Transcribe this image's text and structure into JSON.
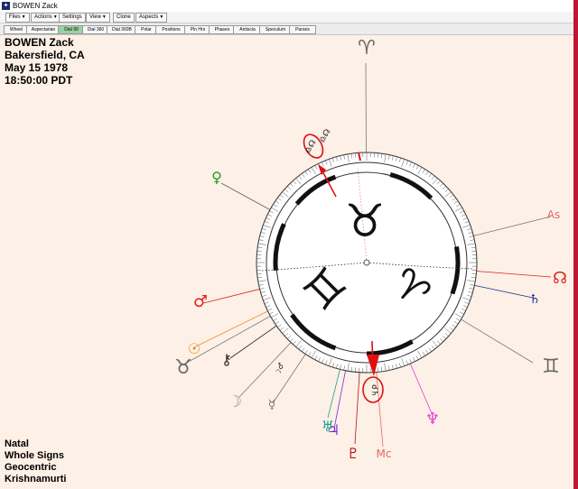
{
  "window": {
    "title": "BOWEN Zack"
  },
  "menu": [
    {
      "label": "Files",
      "dropdown": true
    },
    {
      "label": "Actions",
      "dropdown": true
    },
    {
      "label": "Settings",
      "dropdown": false
    },
    {
      "label": "View",
      "dropdown": true
    },
    {
      "label": "Clone",
      "dropdown": false
    },
    {
      "label": "Aspects",
      "dropdown": true
    }
  ],
  "tabs": [
    "Wheel",
    "Aspectarian",
    "Dial 90",
    "Dial 360",
    "Dial 360B",
    "Polar",
    "Positions",
    "Pln Hrs",
    "Phases",
    "Antiscia",
    "Speculum",
    "Parans"
  ],
  "active_tab": "Dial 90",
  "chart_info": {
    "name": "BOWEN Zack",
    "place": "Bakersfield, CA",
    "date": "May 15 1978",
    "time": "18:50:00  PDT"
  },
  "chart_settings": [
    "Natal",
    "Whole Signs",
    "Geocentric",
    "Krishnamurti"
  ],
  "dial": {
    "center_signs": [
      {
        "name": "taurus",
        "glyph": "♉"
      },
      {
        "name": "gemini",
        "glyph": "♊"
      },
      {
        "name": "aries",
        "glyph": "♈"
      }
    ],
    "outer_glyphs": [
      {
        "name": "aries-glyph",
        "glyph": "♈",
        "color": "#666666"
      },
      {
        "name": "ascendant-label",
        "glyph": "As",
        "color": "#e06a6a"
      },
      {
        "name": "north-node-glyph",
        "glyph": "☊",
        "color": "#e02020"
      },
      {
        "name": "saturn-glyph",
        "glyph": "♄",
        "color": "#1b2a9a"
      },
      {
        "name": "gemini-glyph",
        "glyph": "♊",
        "color": "#666666"
      },
      {
        "name": "neptune-glyph",
        "glyph": "♆",
        "color": "#e040d0"
      },
      {
        "name": "midheaven-label",
        "glyph": "Mc",
        "color": "#e06a6a"
      },
      {
        "name": "pluto-glyph",
        "glyph": "♇",
        "color": "#b01818"
      },
      {
        "name": "jupiter-glyph",
        "glyph": "♃",
        "color": "#7a2ad0"
      },
      {
        "name": "uranus-glyph",
        "glyph": "♅",
        "color": "#18a090"
      },
      {
        "name": "mercury-glyph",
        "glyph": "☿",
        "color": "#777777"
      },
      {
        "name": "moon-glyph",
        "glyph": "☽",
        "color": "#9999aa"
      },
      {
        "name": "chiron-glyph",
        "glyph": "⚷",
        "color": "#222222"
      },
      {
        "name": "taurus-glyph",
        "glyph": "♉",
        "color": "#666666"
      },
      {
        "name": "sun-glyph",
        "glyph": "☉",
        "color": "#ee8822"
      },
      {
        "name": "mars-glyph",
        "glyph": "♂",
        "color": "#e02020"
      },
      {
        "name": "venus-glyph",
        "glyph": "♀",
        "color": "#20a020"
      }
    ],
    "small_labels": [
      {
        "name": "marker-label-top",
        "text": "♎☊"
      },
      {
        "name": "marker-label-bottom",
        "text": "☌♄"
      },
      {
        "name": "marker-label-small",
        "text": "☽♂"
      }
    ],
    "colors": {
      "red_marker": "#e01010",
      "circle_highlight": "#e01010"
    }
  }
}
